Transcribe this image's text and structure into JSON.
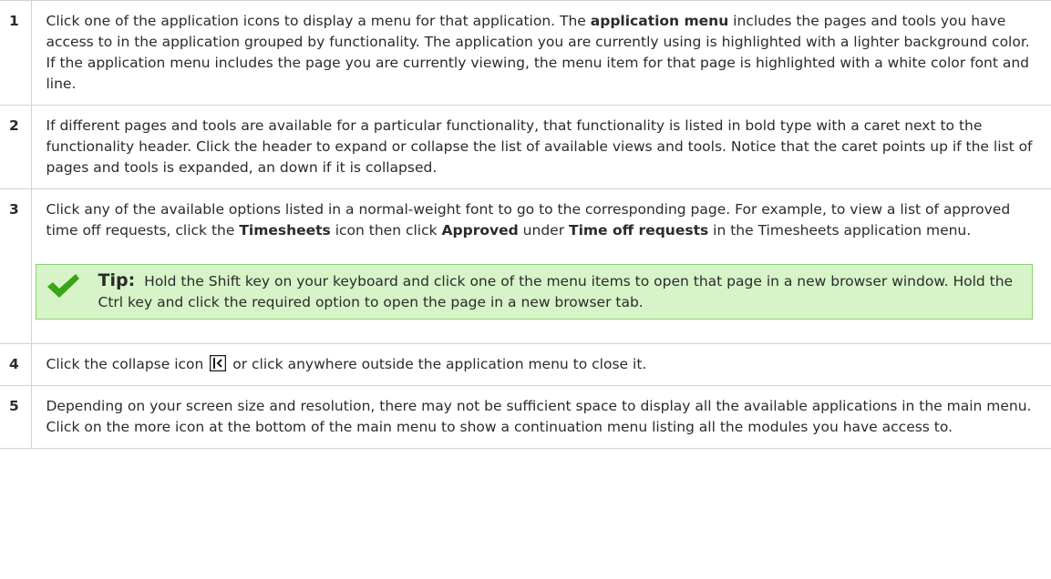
{
  "steps": [
    {
      "number": "1",
      "parts": [
        "Click one of the application icons to display a menu for that application. The ",
        "application menu",
        " includes the pages and tools you have access to in the application grouped by functionality. The application you are currently using is highlighted with a lighter background color. If the application menu includes the page you are currently viewing, the menu item for that page is highlighted with a white color font and line."
      ]
    },
    {
      "number": "2",
      "text": "If different pages and tools are available for a particular functionality, that functionality is listed in bold type with a caret next to the functionality header. Click the header to expand or collapse the list of available views and tools. Notice that the caret points up if the list of pages and tools is expanded, an down if it is collapsed."
    },
    {
      "number": "3",
      "parts": [
        "Click any of the available options listed in a normal-weight font to go to the corresponding page. For example, to view a list of approved time off requests, click the ",
        "Timesheets",
        " icon then click ",
        "Approved",
        " under ",
        "Time off requests",
        " in the Timesheets application menu."
      ],
      "tip": {
        "label": "Tip:",
        "text": "Hold the Shift key on your keyboard and click one of the menu items to open that page in a new browser window. Hold the Ctrl key and click the required option to open the page in a new browser tab.",
        "icon": "check-icon",
        "background": "#d7f4c8",
        "check_color": "#3aa317"
      }
    },
    {
      "number": "4",
      "before_icon": "Click the collapse icon",
      "icon": "collapse-icon",
      "after_icon": "or click anywhere outside the application menu to close it."
    },
    {
      "number": "5",
      "text": "Depending on your screen size and resolution, there may not be sufficient space to display all the available applications in the main menu. Click on the more icon at the bottom of the main menu to show a continuation menu listing all the modules you have access to."
    }
  ]
}
